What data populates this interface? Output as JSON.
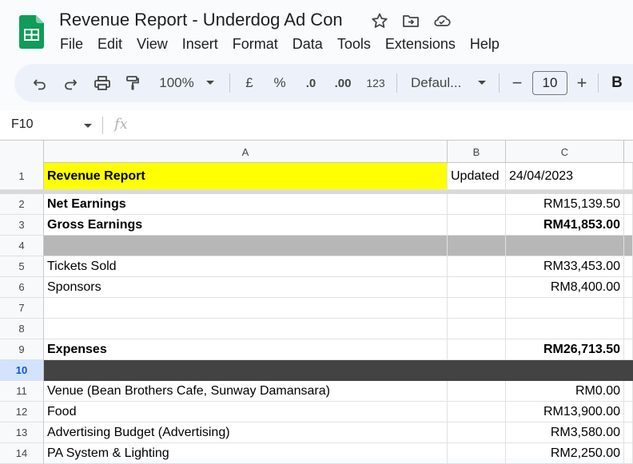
{
  "app": {
    "title": "Revenue Report - Underdog Ad Con",
    "logo_icon": "google-sheets-logo",
    "title_icons": [
      "star-icon",
      "move-to-folder-icon",
      "cloud-saved-icon"
    ],
    "colors": {
      "logo_green": "#0f9d58",
      "highlight_yellow": "#ffff00",
      "gray_band": "#b7b7b7",
      "dark_band": "#434343",
      "selection_blue": "#0b57d0"
    }
  },
  "menu": [
    "File",
    "Edit",
    "View",
    "Insert",
    "Format",
    "Data",
    "Tools",
    "Extensions",
    "Help"
  ],
  "toolbar": {
    "undo_icon": "undo-icon",
    "redo_icon": "redo-icon",
    "print_icon": "print-icon",
    "paint_format_icon": "paint-format-icon",
    "zoom": "100%",
    "currency": "£",
    "percent": "%",
    "decrease_decimal": ".0",
    "increase_decimal": ".00",
    "number_format": "123",
    "font": "Defaul...",
    "decrease_font_size": "−",
    "font_size": "10",
    "increase_font_size": "+",
    "bold": "B"
  },
  "formula_bar": {
    "cell_ref": "F10",
    "fx": "fx",
    "value": ""
  },
  "columns": [
    "A",
    "B",
    "C"
  ],
  "rows": [
    {
      "num": "1",
      "a": "Revenue Report",
      "b": "Updated",
      "c": "24/04/2023"
    },
    {
      "num": "2",
      "a": "Net Earnings",
      "b": "",
      "c": "RM15,139.50"
    },
    {
      "num": "3",
      "a": "Gross Earnings",
      "b": "",
      "c": "RM41,853.00"
    },
    {
      "num": "4",
      "a": "",
      "b": "",
      "c": ""
    },
    {
      "num": "5",
      "a": "Tickets Sold",
      "b": "",
      "c": "RM33,453.00"
    },
    {
      "num": "6",
      "a": "Sponsors",
      "b": "",
      "c": "RM8,400.00"
    },
    {
      "num": "7",
      "a": "",
      "b": "",
      "c": ""
    },
    {
      "num": "8",
      "a": "",
      "b": "",
      "c": ""
    },
    {
      "num": "9",
      "a": "Expenses",
      "b": "",
      "c": "RM26,713.50"
    },
    {
      "num": "10",
      "a": "",
      "b": "",
      "c": ""
    },
    {
      "num": "11",
      "a": "Venue (Bean Brothers Cafe, Sunway Damansara)",
      "b": "",
      "c": "RM0.00"
    },
    {
      "num": "12",
      "a": "Food",
      "b": "",
      "c": "RM13,900.00"
    },
    {
      "num": "13",
      "a": "Advertising Budget (Advertising)",
      "b": "",
      "c": "RM3,580.00"
    },
    {
      "num": "14",
      "a": "PA System & Lighting",
      "b": "",
      "c": "RM2,250.00"
    }
  ]
}
